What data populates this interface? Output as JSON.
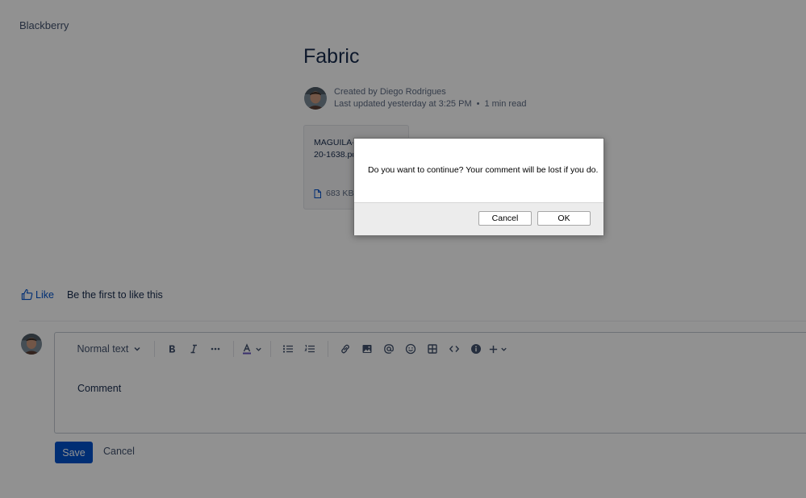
{
  "space": {
    "name": "Blackberry"
  },
  "page": {
    "title": "Fabric",
    "created_by": "Created by Diego Rodrigues",
    "last_updated": "Last updated yesterday at 3:25 PM",
    "read_time": "1 min read",
    "separator": "•"
  },
  "attachment": {
    "name": "MAGUILA-040520-1638.pdf",
    "size": "683 KB",
    "icon": "file-icon"
  },
  "likes": {
    "like_label": "Like",
    "message": "Be the first to like this"
  },
  "editor": {
    "text_style": "Normal text",
    "placeholder": "Comment",
    "tools": [
      "bold-icon",
      "italic-icon",
      "more-formatting-icon",
      "text-color-icon",
      "bullet-list-icon",
      "numbered-list-icon",
      "link-icon",
      "image-icon",
      "mention-icon",
      "emoji-icon",
      "table-icon",
      "code-icon",
      "info-icon",
      "insert-plus-icon"
    ]
  },
  "actions": {
    "save_label": "Save",
    "cancel_label": "Cancel"
  },
  "dialog": {
    "message": "Do you want to continue? Your comment will be lost if you do.",
    "cancel_label": "Cancel",
    "ok_label": "OK"
  },
  "colors": {
    "primary": "#0052cc",
    "text": "#172b4d",
    "muted": "#5e6c84"
  }
}
